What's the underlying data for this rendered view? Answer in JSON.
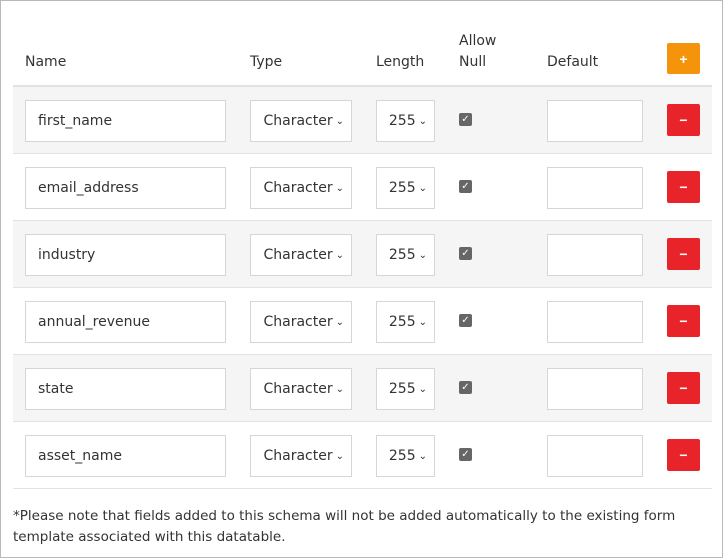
{
  "headers": {
    "name": "Name",
    "type": "Type",
    "length": "Length",
    "allow_null_1": "Allow",
    "allow_null_2": "Null",
    "default": "Default",
    "add_label": "+"
  },
  "rows": [
    {
      "name": "first_name",
      "type": "Character",
      "length": "255",
      "allow_null": true,
      "default": ""
    },
    {
      "name": "email_address",
      "type": "Character",
      "length": "255",
      "allow_null": true,
      "default": ""
    },
    {
      "name": "industry",
      "type": "Character",
      "length": "255",
      "allow_null": true,
      "default": ""
    },
    {
      "name": "annual_revenue",
      "type": "Character",
      "length": "255",
      "allow_null": true,
      "default": ""
    },
    {
      "name": "state",
      "type": "Character",
      "length": "255",
      "allow_null": true,
      "default": ""
    },
    {
      "name": "asset_name",
      "type": "Character",
      "length": "255",
      "allow_null": true,
      "default": ""
    }
  ],
  "remove_label": "−",
  "note": "*Please note that fields added to this schema will not be added automatically to the existing form template associated with this datatable.",
  "colors": {
    "add": "#f5930b",
    "remove": "#e8242a"
  }
}
